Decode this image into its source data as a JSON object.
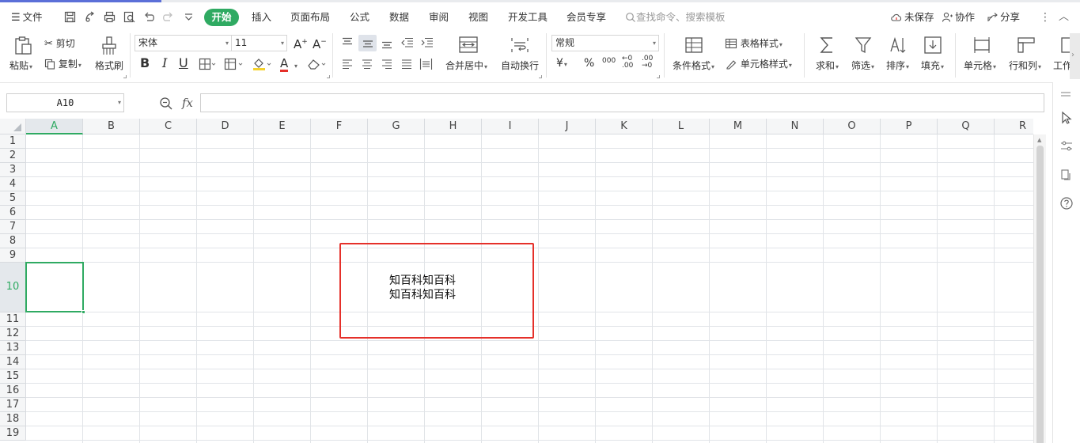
{
  "menubar": {
    "file": "文件",
    "tabs": [
      "开始",
      "插入",
      "页面布局",
      "公式",
      "数据",
      "审阅",
      "视图",
      "开发工具",
      "会员专享"
    ],
    "active_tab_index": 0,
    "search_placeholder": "查找命令、搜索模板",
    "unsaved": "未保存",
    "collaborate": "协作",
    "share": "分享"
  },
  "ribbon": {
    "paste": "粘贴",
    "cut": "剪切",
    "copy": "复制",
    "format_painter": "格式刷",
    "font_name": "宋体",
    "font_size": "11",
    "bold": "B",
    "italic": "I",
    "underline": "U",
    "font_color_letter": "A",
    "merge_center": "合并居中",
    "wrap_text": "自动换行",
    "number_format": "常规",
    "currency": "¥",
    "percent": "%",
    "thousands": "000",
    "dec_increase": "←0 .00",
    "dec_decrease": ".00 →0",
    "conditional_format": "条件格式",
    "table_style": "表格样式",
    "cell_style": "单元格样式",
    "sum": "求和",
    "filter": "筛选",
    "sort": "排序",
    "fill": "填充",
    "cell": "单元格",
    "row_col": "行和列",
    "worksheet": "工作"
  },
  "formula_bar": {
    "name_box": "A10",
    "fx": "fx",
    "value": ""
  },
  "sheet": {
    "columns": [
      "A",
      "B",
      "C",
      "D",
      "E",
      "F",
      "G",
      "H",
      "I",
      "J",
      "K",
      "L",
      "M",
      "N",
      "O",
      "P",
      "Q",
      "R"
    ],
    "rows": [
      "1",
      "2",
      "3",
      "4",
      "5",
      "6",
      "7",
      "8",
      "9",
      "10",
      "11",
      "12",
      "13",
      "14",
      "15",
      "16",
      "17",
      "18",
      "19"
    ],
    "selected_column": "A",
    "selected_row": "10",
    "cell_lines": [
      "知百科知百科",
      "知百科知百科"
    ]
  },
  "colors": {
    "accent_green": "#2faa62",
    "highlight_red": "#e5302a"
  }
}
